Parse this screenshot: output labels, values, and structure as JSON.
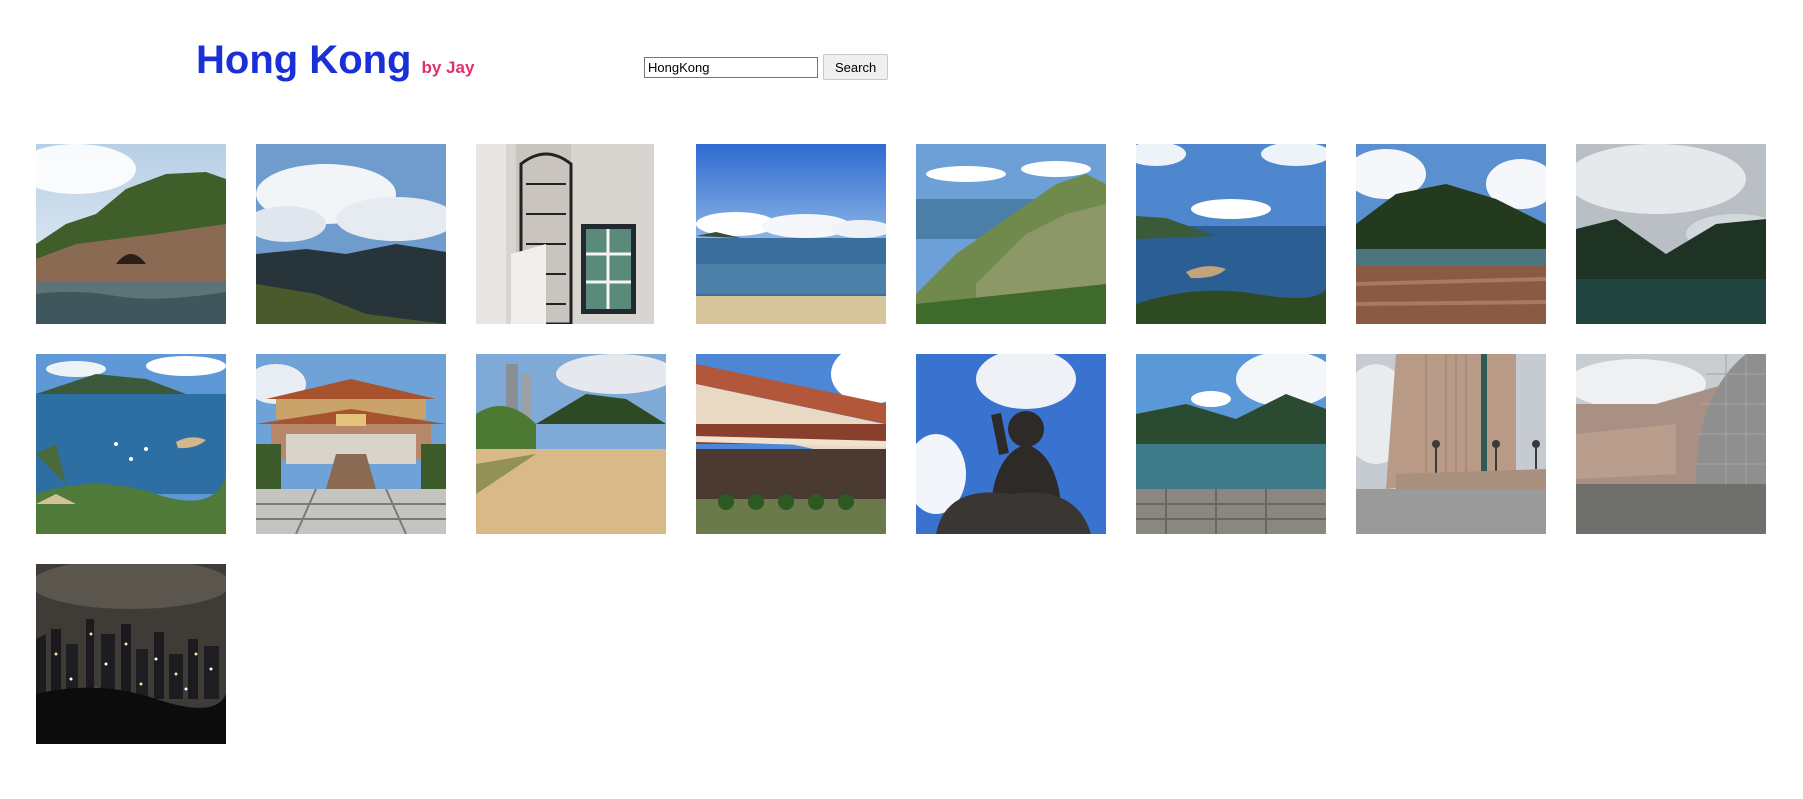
{
  "header": {
    "title": "Hong Kong",
    "byline": "by Jay"
  },
  "search": {
    "value": "HongKong",
    "button_label": "Search"
  },
  "gallery": {
    "photos": [
      {
        "subject": "rocky island with cave and sea"
      },
      {
        "subject": "clouds over hills and bay"
      },
      {
        "subject": "spiral staircase and window"
      },
      {
        "subject": "beach with blue sky and clouds"
      },
      {
        "subject": "green hillside overlooking sea"
      },
      {
        "subject": "bay with small island"
      },
      {
        "subject": "green mountain over pebble shore"
      },
      {
        "subject": "dark hills over lake under cloudy sky"
      },
      {
        "subject": "bay with boats and hills"
      },
      {
        "subject": "temple with stairs"
      },
      {
        "subject": "sandy beach with trees and towers"
      },
      {
        "subject": "temple building with balcony"
      },
      {
        "subject": "big buddha statue under clouds"
      },
      {
        "subject": "reservoir with hills"
      },
      {
        "subject": "tall building with lamp posts"
      },
      {
        "subject": "modern museum building"
      },
      {
        "subject": "city skyline at night"
      }
    ]
  }
}
